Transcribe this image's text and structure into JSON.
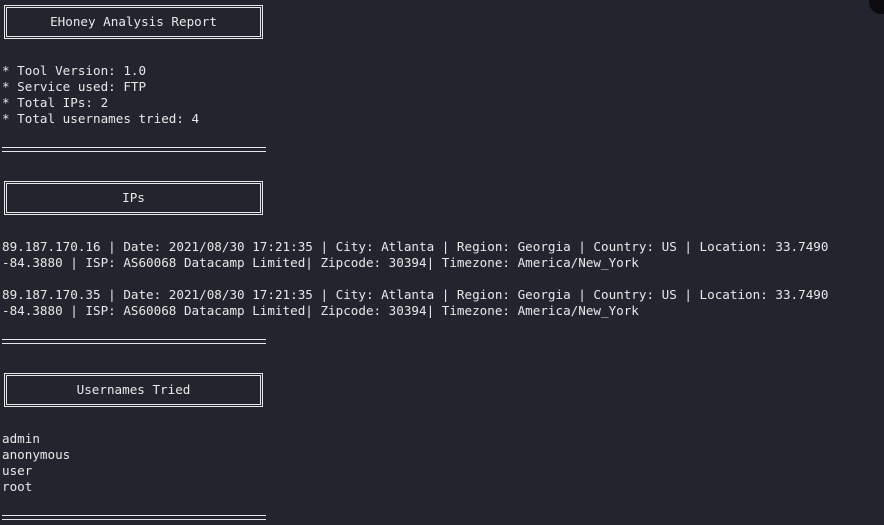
{
  "report": {
    "title": "EHoney Analysis Report",
    "summary": [
      "* Tool Version: 1.0",
      "* Service used: FTP",
      "* Total IPs: 2",
      "* Total usernames tried: 4"
    ]
  },
  "ips_section": {
    "heading": "IPs",
    "entries": [
      {
        "line1": "89.187.170.16 | Date: 2021/08/30 17:21:35 | City: Atlanta | Region: Georgia | Country: US | Location: 33.7490",
        "line2": "-84.3880 | ISP: AS60068 Datacamp Limited| Zipcode: 30394| Timezone: America/New_York"
      },
      {
        "line1": "89.187.170.35 | Date: 2021/08/30 17:21:35 | City: Atlanta | Region: Georgia | Country: US | Location: 33.7490",
        "line2": "-84.3880 | ISP: AS60068 Datacamp Limited| Zipcode: 30394| Timezone: America/New_York"
      }
    ]
  },
  "usernames_section": {
    "heading": "Usernames Tried",
    "usernames": [
      "admin",
      "anonymous",
      "user",
      "root"
    ]
  },
  "colors": {
    "background": "#23252e",
    "foreground": "#e8e8e8"
  }
}
